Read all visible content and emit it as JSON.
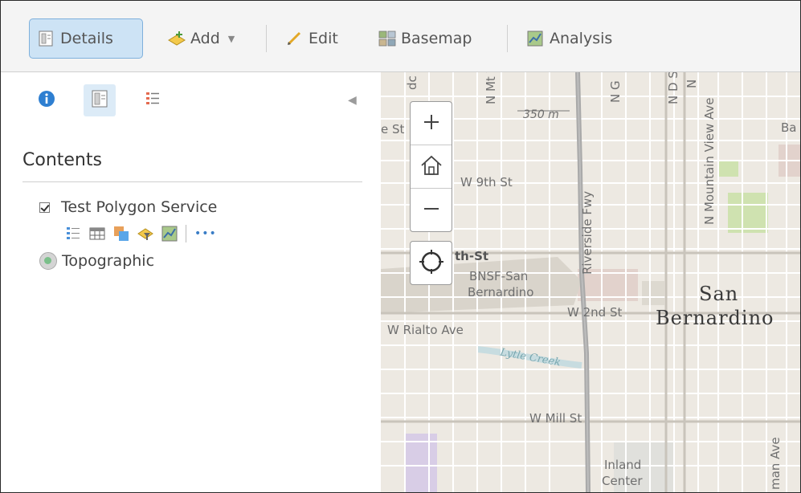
{
  "toolbar": {
    "details_label": "Details",
    "add_label": "Add",
    "edit_label": "Edit",
    "basemap_label": "Basemap",
    "analysis_label": "Analysis"
  },
  "panel": {
    "contents_title": "Contents",
    "layers": [
      {
        "name": "Test Polygon Service",
        "checked": true
      },
      {
        "name": "Topographic"
      }
    ],
    "more_label": "•••"
  },
  "map": {
    "scale_label": "350 m",
    "labels": {
      "w9th": "W 9th St",
      "th_st": "th-St",
      "bnsf": "BNSF-San",
      "bernardino_small": "Bernardino",
      "w2nd": "W 2nd St",
      "rialto": "W Rialto Ave",
      "lytle": "Lytle Creek",
      "wmill": "W Mill St",
      "inland": "Inland",
      "center": "Center",
      "city1": "San",
      "city2": "Bernardino",
      "riverside": "Riverside Fwy",
      "mountain_view": "N Mountain View Ave",
      "n_g": "N G",
      "n_mt": "N Mt V",
      "n_d": "N D S",
      "n_s": "N",
      "e_st": "e St",
      "ba": "Ba",
      "dc": "dc",
      "man_ave": "man Ave"
    }
  },
  "colors": {
    "accent": "#7fb0dc",
    "active_bg": "#cde3f5",
    "map_bg": "#ede9e2",
    "freeway": "#a9a9a9",
    "park": "#cfe2b0",
    "water": "#c7dce0"
  }
}
